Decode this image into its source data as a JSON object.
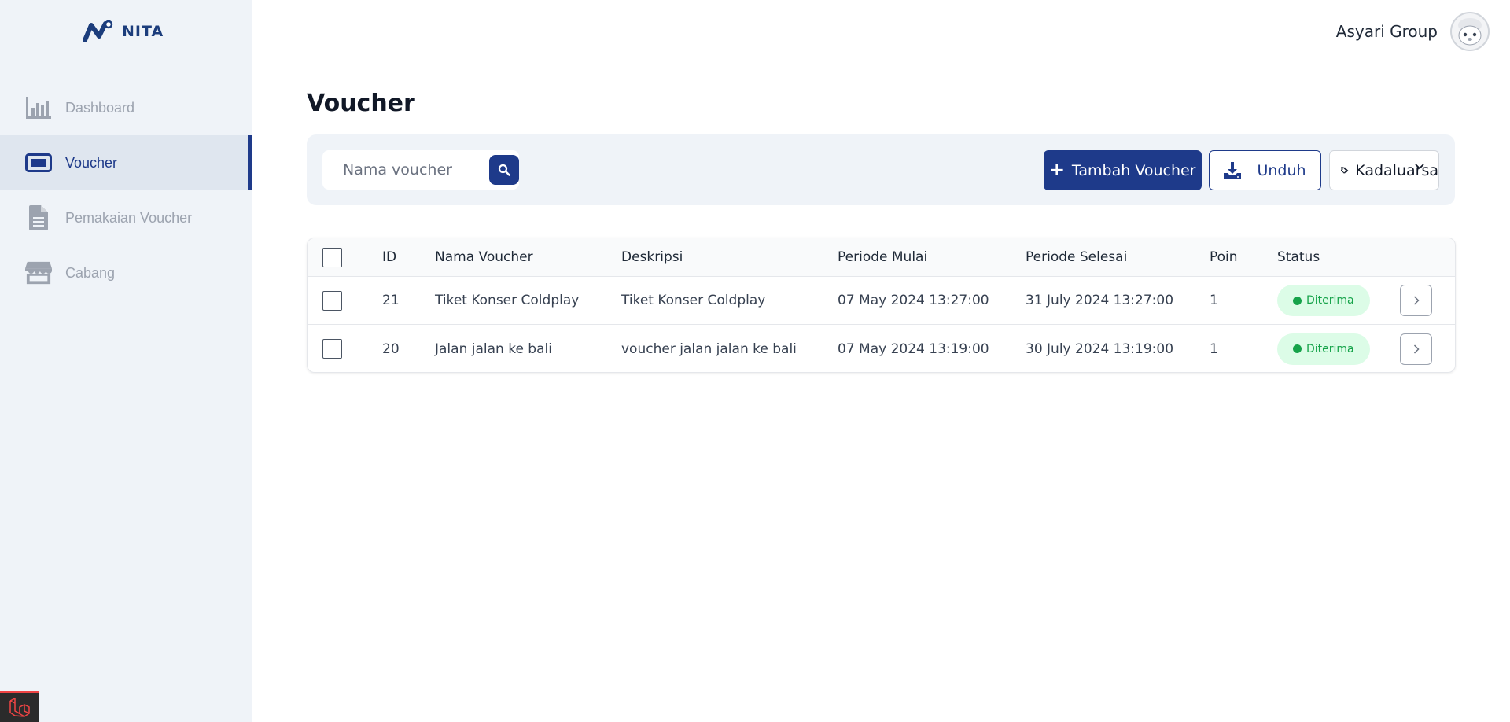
{
  "brand": {
    "name": "NITA"
  },
  "sidebar": {
    "items": [
      {
        "label": "Dashboard",
        "icon": "bar-chart-icon",
        "active": false
      },
      {
        "label": "Voucher",
        "icon": "ticket-icon",
        "active": true
      },
      {
        "label": "Pemakaian Voucher",
        "icon": "document-icon",
        "active": false
      },
      {
        "label": "Cabang",
        "icon": "store-icon",
        "active": false
      }
    ]
  },
  "header": {
    "user_name": "Asyari Group"
  },
  "page": {
    "title": "Voucher"
  },
  "toolbar": {
    "search_placeholder": "Nama voucher",
    "add_label": "Tambah Voucher",
    "download_label": "Unduh",
    "filter_value": "Kadaluarsa"
  },
  "table": {
    "columns": [
      "ID",
      "Nama Voucher",
      "Deskripsi",
      "Periode Mulai",
      "Periode Selesai",
      "Poin",
      "Status"
    ],
    "rows": [
      {
        "id": "21",
        "name": "Tiket Konser Coldplay",
        "desc": "Tiket Konser Coldplay",
        "start": "07 May 2024 13:27:00",
        "end": "31 July 2024 13:27:00",
        "poin": "1",
        "status": "Diterima"
      },
      {
        "id": "20",
        "name": "Jalan jalan ke bali",
        "desc": "voucher jalan jalan ke bali",
        "start": "07 May 2024 13:19:00",
        "end": "30 July 2024 13:19:00",
        "poin": "1",
        "status": "Diterima"
      }
    ]
  },
  "colors": {
    "primary": "#1e3a8a",
    "sidebar_bg": "#eff3f8",
    "success": "#16a34a",
    "success_bg": "#dcfce7"
  }
}
